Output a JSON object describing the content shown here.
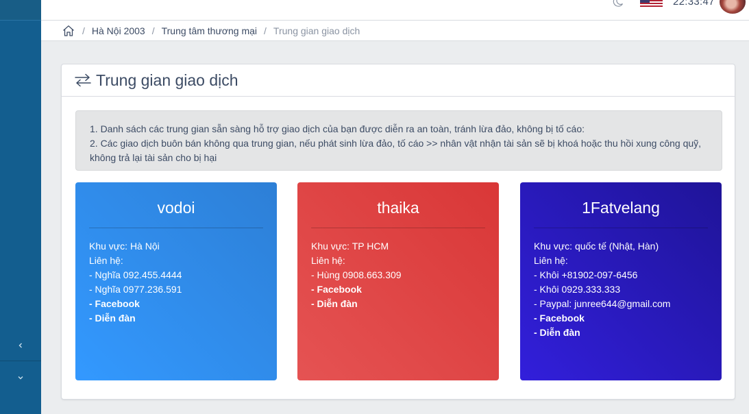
{
  "header": {
    "clock": "22:33:47",
    "icons": {
      "theme": "moon-icon",
      "language": "us-flag-icon",
      "avatar": "user-avatar"
    }
  },
  "breadcrumb": {
    "items": [
      "Hà Nội 2003",
      "Trung tâm thương mại"
    ],
    "active": "Trung gian giao dịch",
    "separator": "/"
  },
  "page": {
    "title": "Trung gian giao dịch",
    "notice": [
      "1. Danh sách các trung gian sẵn sàng hỗ trợ giao dịch của bạn được diễn ra an toàn, tránh lừa đảo, không bị tố cáo:",
      "2. Các giao dịch buôn bán không qua trung gian, nếu phát sinh lừa đảo, tố cáo >> nhân vật nhận tài sản sẽ bị khoá hoặc thu hồi xung công quỹ, không trả lại tài sản cho bị hại"
    ]
  },
  "middlemen": [
    {
      "name": "vodoi",
      "area": "Khu vực: Hà Nội",
      "contact_label": "Liên hệ:",
      "contacts": [
        "- Nghĩa 092.455.4444",
        "- Nghĩa 0977.236.591"
      ],
      "facebook": "- Facebook",
      "forum": "- Diễn đàn",
      "color": "#3399ff"
    },
    {
      "name": "thaika",
      "area": "Khu vực: TP HCM",
      "contact_label": "Liên hệ:",
      "contacts": [
        "- Hùng 0908.663.309"
      ],
      "facebook": "- Facebook",
      "forum": "- Diễn đàn",
      "color": "#e55353"
    },
    {
      "name": "1Fatvelang",
      "area": "Khu vực: quốc tế (Nhật, Hàn)",
      "contact_label": "Liên hệ:",
      "contacts": [
        "- Khôi +81902-097-6456",
        "- Khôi 0929.333.333",
        "- Paypal: junree644@gmail.com"
      ],
      "facebook": "- Facebook",
      "forum": "- Diễn đàn",
      "color": "#321fdb"
    }
  ]
}
